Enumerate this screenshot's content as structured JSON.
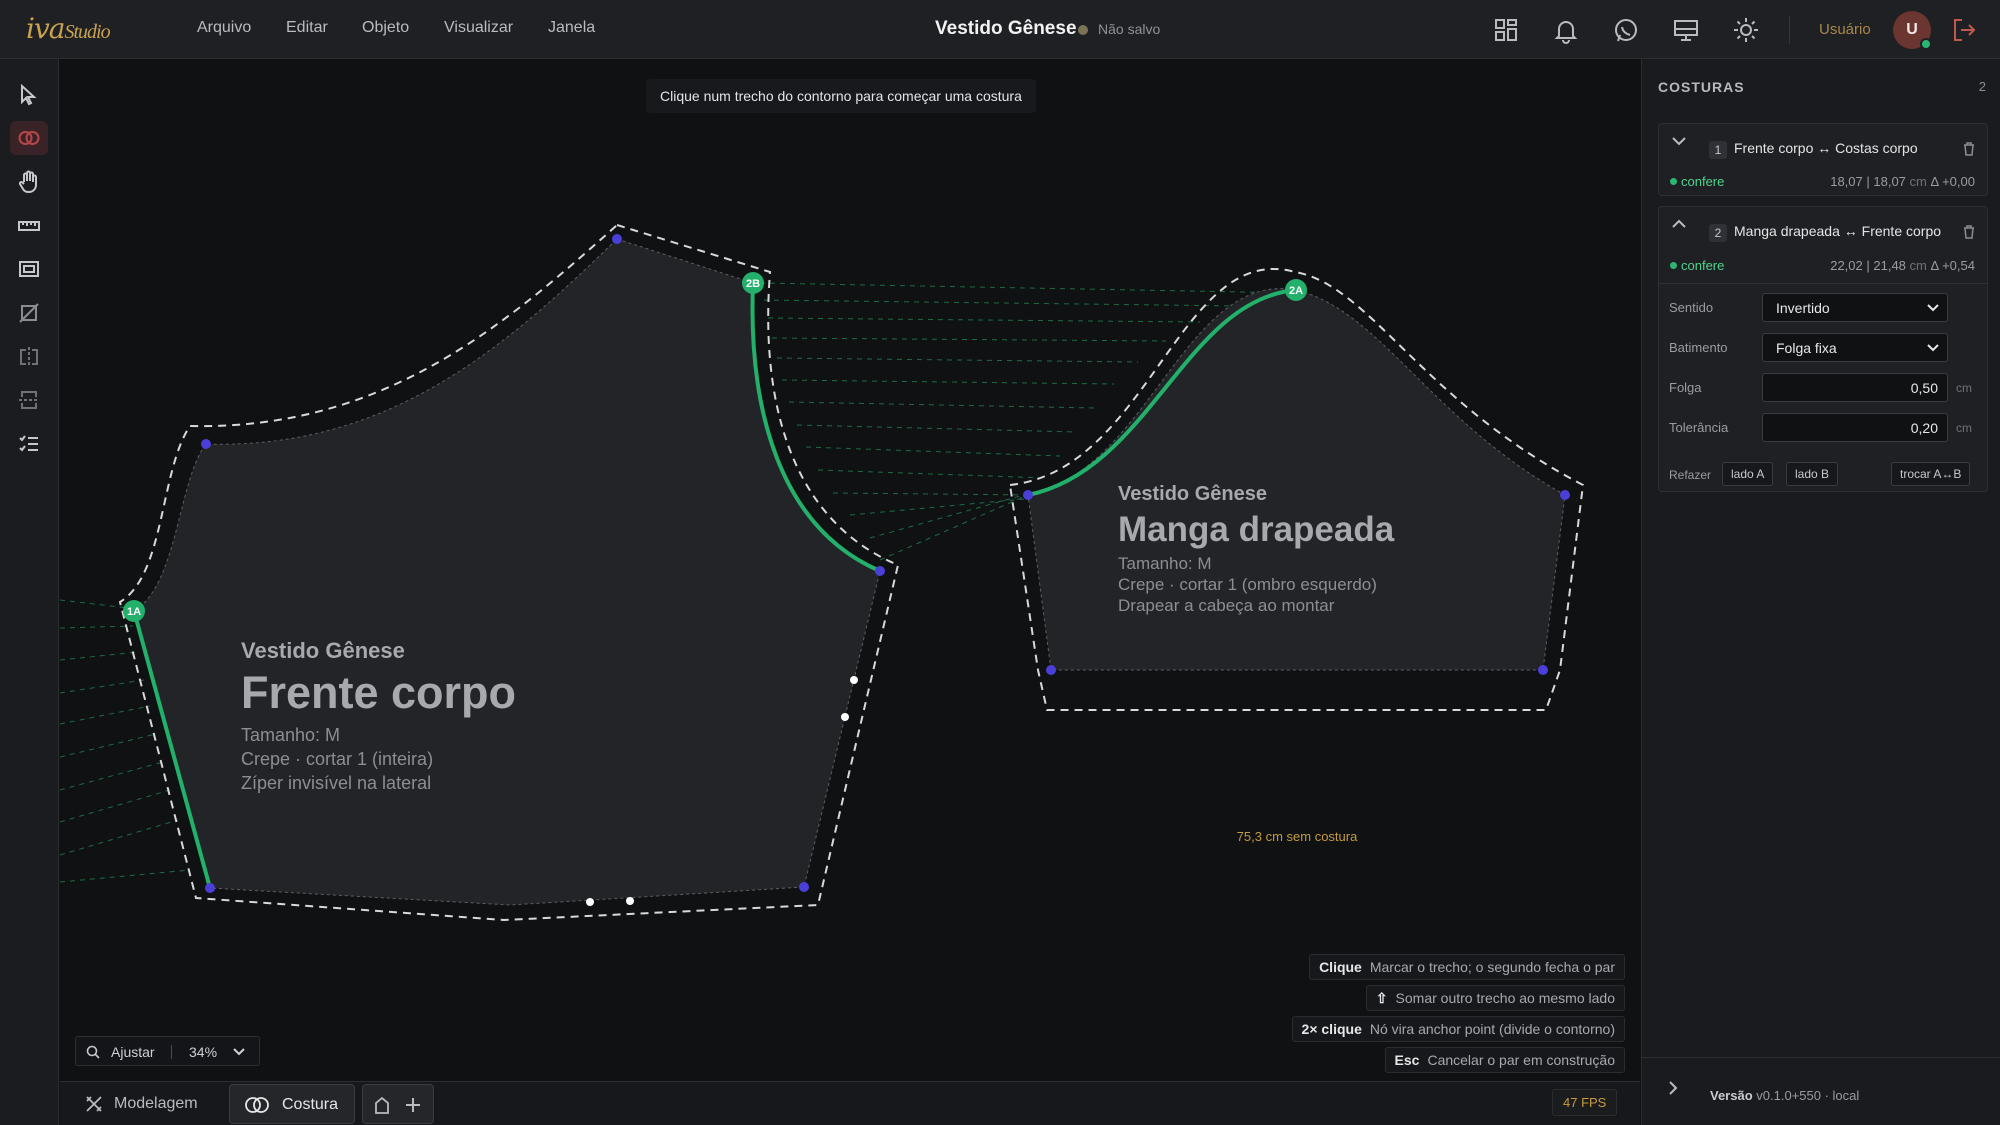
{
  "app": {
    "logo_main": "iva",
    "logo_sub": "Studio",
    "menu": [
      "Arquivo",
      "Editar",
      "Objeto",
      "Visualizar",
      "Janela"
    ],
    "doc_title": "Vestido Gênese",
    "save_status": "Não salvo",
    "user_label": "Usuário",
    "avatar_initial": "U"
  },
  "toolbar_icons": [
    "pointer-icon",
    "seam-tool-icon",
    "hand-icon",
    "ruler-icon",
    "frame-icon",
    "no-fill-icon",
    "mirror-icon",
    "align-icon",
    "checklist-icon"
  ],
  "topbar_icons": [
    "grid-icon",
    "bell-icon",
    "whatsapp-icon",
    "monitor-icon",
    "sun-icon",
    "logout-icon"
  ],
  "canvas": {
    "hint": "Clique num trecho do contorno para começar uma costura",
    "unsewn_label": "75,3 cm sem costura",
    "pieces": {
      "front": {
        "model": "Vestido Gênese",
        "name": "Frente corpo",
        "size": "Tamanho: M",
        "fabric": "Crepe · cortar 1 (inteira)",
        "note": "Zíper invisível na lateral"
      },
      "sleeve": {
        "model": "Vestido Gênese",
        "name": "Manga drapeada",
        "size": "Tamanho: M",
        "fabric": "Crepe · cortar 1 (ombro esquerdo)",
        "note": "Drapear a cabeça ao montar"
      }
    },
    "markers": {
      "m1a": "1A",
      "m2b": "2B",
      "m2a": "2A"
    },
    "shortcuts": [
      {
        "key": "Clique",
        "desc": "Marcar o trecho; o segundo fecha o par"
      },
      {
        "key": "⇧",
        "desc": "Somar outro trecho ao mesmo lado"
      },
      {
        "key": "2× clique",
        "desc": "Nó vira anchor point (divide o contorno)"
      },
      {
        "key": "Esc",
        "desc": "Cancelar o par em construção"
      }
    ],
    "zoom": {
      "fit_label": "Ajustar",
      "value": "34%"
    }
  },
  "bottom": {
    "tabs": [
      {
        "label": "Modelagem",
        "icon": "pattern-icon"
      },
      {
        "label": "Costura",
        "icon": "rings-icon"
      }
    ],
    "fps": "47 FPS"
  },
  "panel": {
    "title": "COSTURAS",
    "count": "2",
    "seams": [
      {
        "index": "1",
        "name": "Frente corpo ↔ Costas corpo",
        "status": "confere",
        "len_a": "18,07",
        "len_b": "18,07",
        "unit": "cm",
        "delta": "Δ +0,00"
      },
      {
        "index": "2",
        "name": "Manga drapeada ↔ Frente corpo",
        "status": "confere",
        "len_a": "22,02",
        "len_b": "21,48",
        "unit": "cm",
        "delta": "Δ +0,54",
        "fields": {
          "sentido_label": "Sentido",
          "sentido_value": "Invertido",
          "batimento_label": "Batimento",
          "batimento_value": "Folga fixa",
          "folga_label": "Folga",
          "folga_value": "0,50",
          "tolerancia_label": "Tolerância",
          "tolerancia_value": "0,20",
          "unit": "cm",
          "refazer_label": "Refazer",
          "btn_lado_a": "lado A",
          "btn_lado_b": "lado B",
          "btn_trocar": "trocar A↔B"
        }
      }
    ],
    "version_label": "Versão",
    "version_value": "v0.1.0+550 · local"
  },
  "colors": {
    "accent_green": "#22b06a",
    "node_blue": "#4b3fd9",
    "warning_orange": "#c59b3d",
    "brand_gold": "#c9a24f"
  }
}
